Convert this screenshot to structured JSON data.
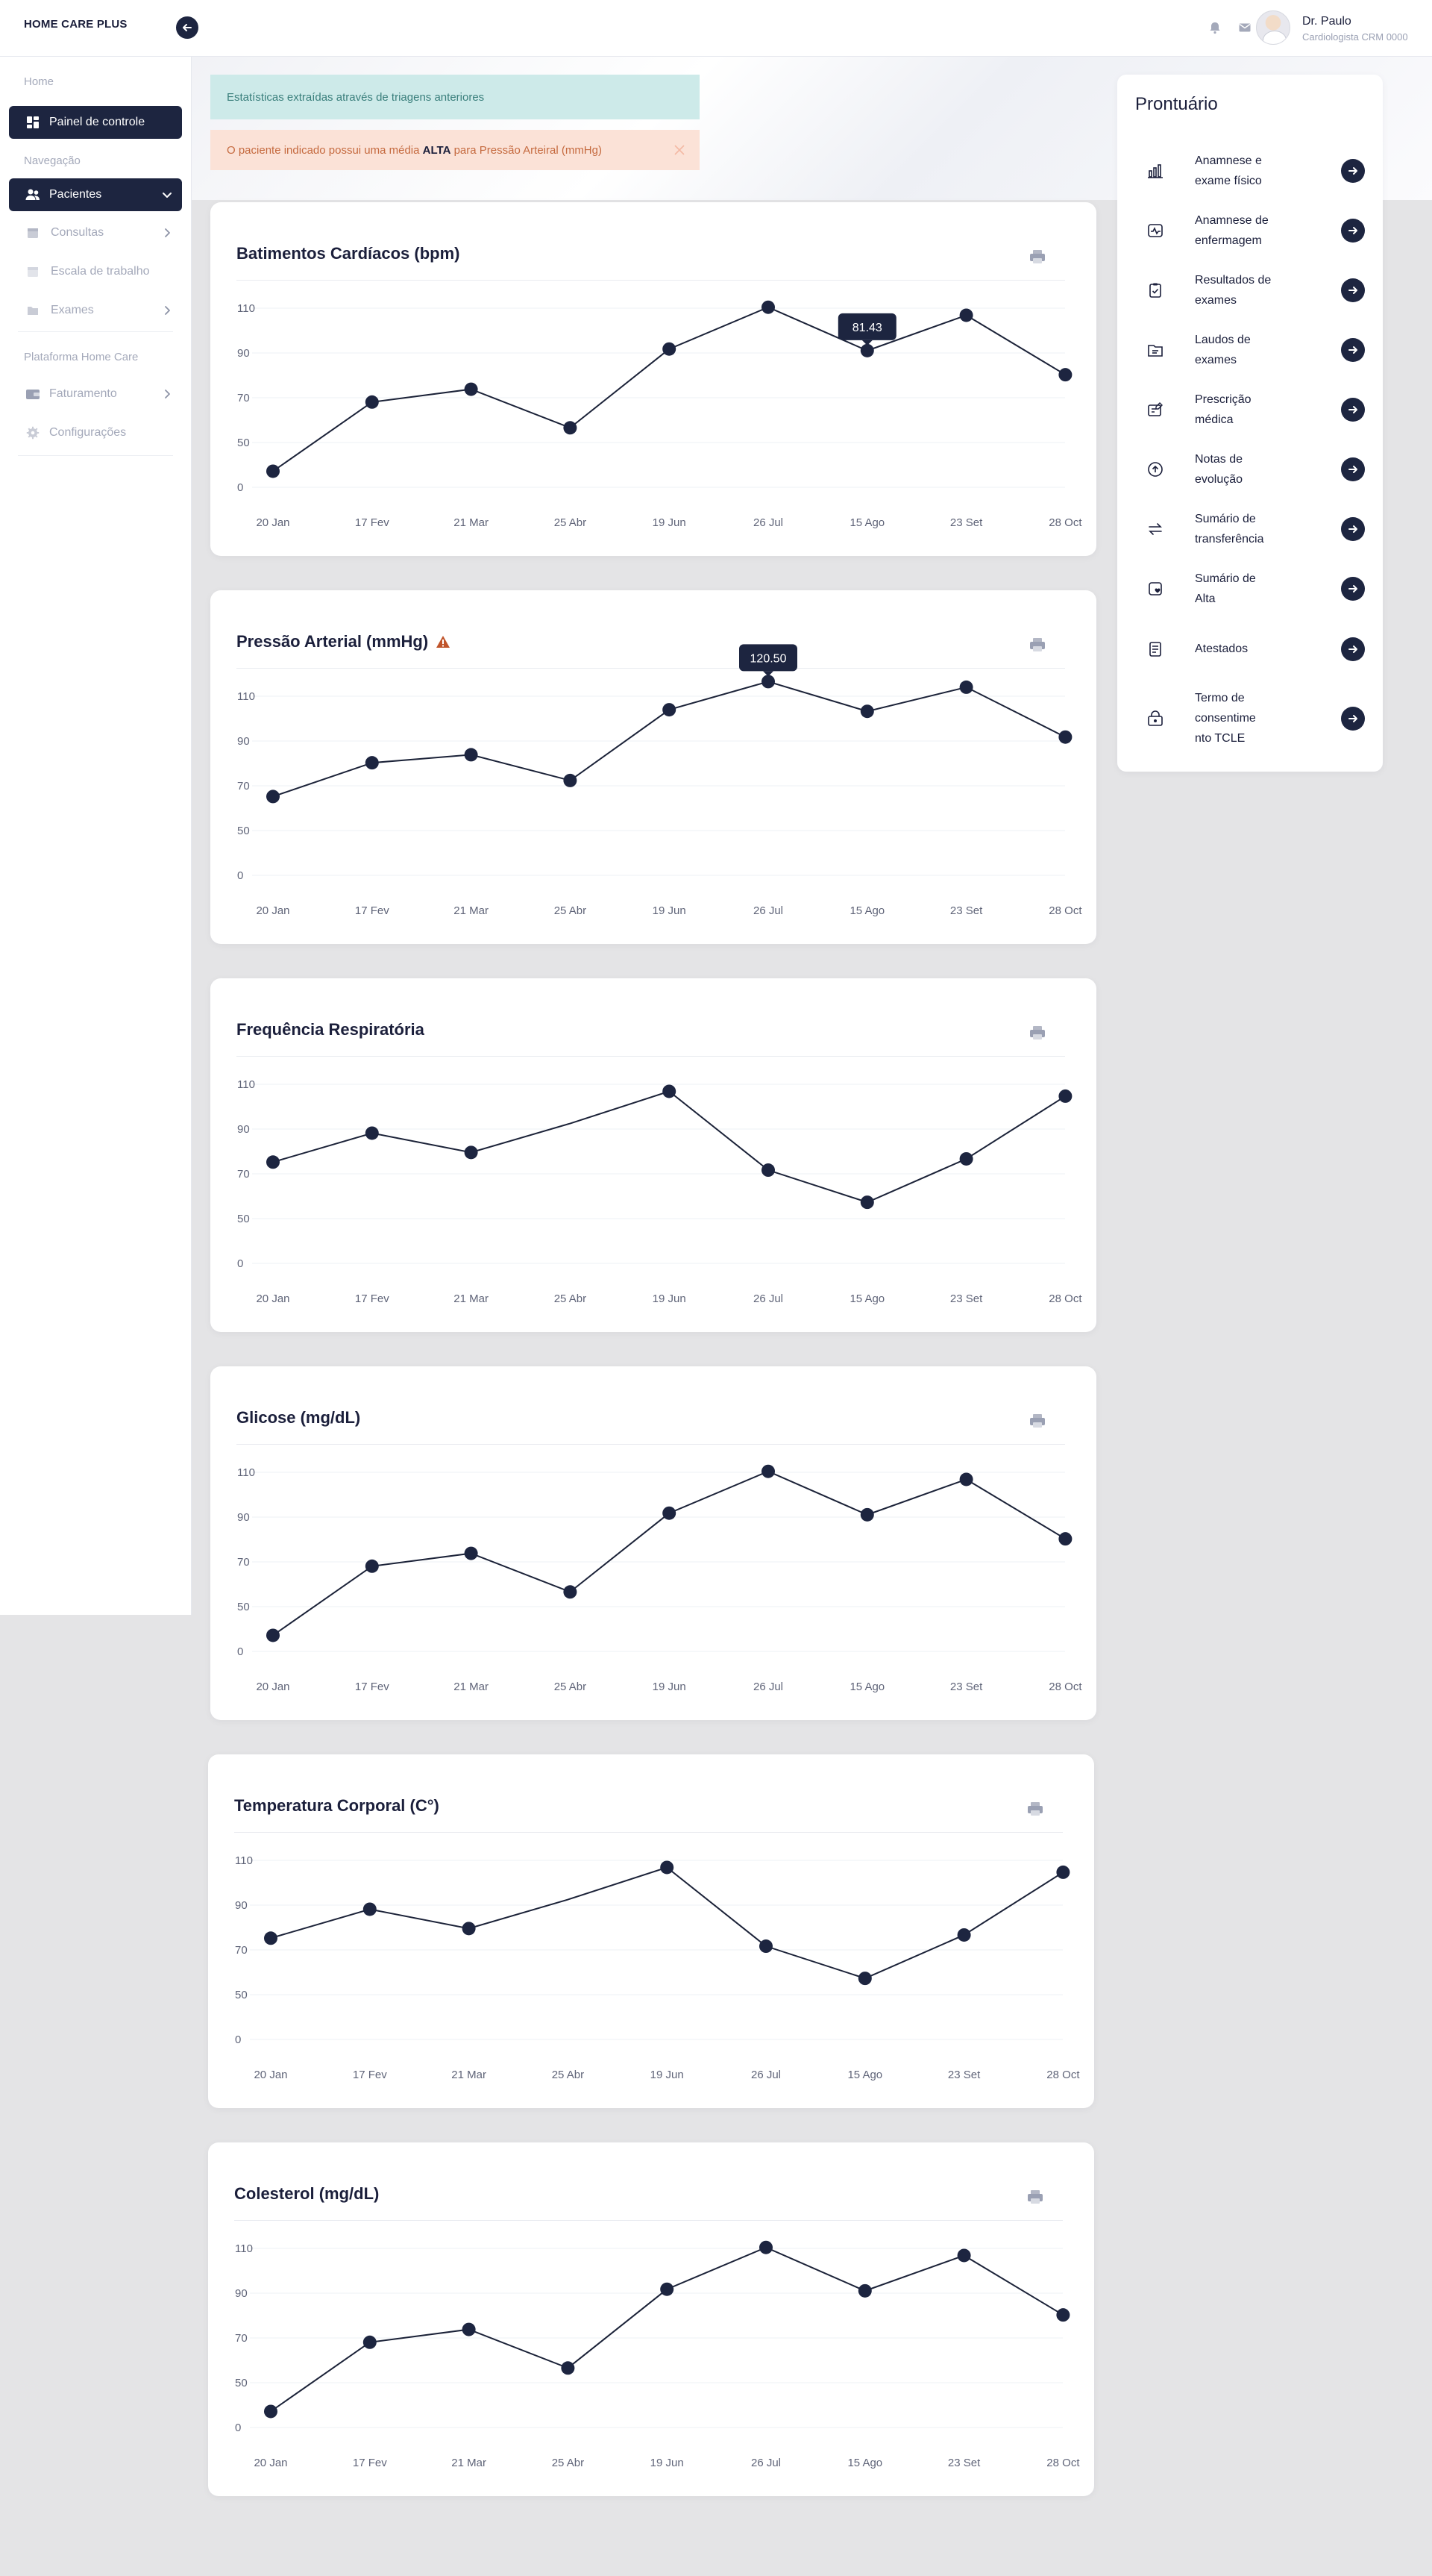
{
  "app": {
    "brand": "HOME CARE PLUS"
  },
  "user": {
    "name": "Dr. Paulo",
    "role": "Cardiologista CRM 0000"
  },
  "sidebar": {
    "sections": {
      "home": "Home",
      "nav": "Navegação",
      "platform": "Plataforma Home Care"
    },
    "items": [
      {
        "label": "Painel de controle",
        "icon": "dashboard-icon"
      },
      {
        "label": "Pacientes",
        "icon": "users-icon"
      },
      {
        "label": "Consultas",
        "icon": "calendar-icon"
      },
      {
        "label": "Escala de trabalho",
        "icon": "calendar-icon"
      },
      {
        "label": "Exames",
        "icon": "folder-icon"
      },
      {
        "label": "Faturamento",
        "icon": "wallet-icon"
      },
      {
        "label": "Configurações",
        "icon": "gear-icon"
      }
    ]
  },
  "alerts": {
    "info": "Estatísticas extraídas através de triagens anteriores",
    "warn_prefix": "O paciente indicado possui uma média ",
    "warn_bold": "ALTA",
    "warn_suffix": " para Pressão Arteiral (mmHg)"
  },
  "panel": {
    "title": "Prontuário",
    "items": [
      {
        "line1": "Anamnese e",
        "line2": "exame físico",
        "line3": ""
      },
      {
        "line1": "Anamnese de",
        "line2": "enfermagem",
        "line3": ""
      },
      {
        "line1": "Resultados de",
        "line2": "exames",
        "line3": ""
      },
      {
        "line1": "Laudos de",
        "line2": "exames",
        "line3": ""
      },
      {
        "line1": "Prescrição",
        "line2": "médica",
        "line3": ""
      },
      {
        "line1": "Notas de",
        "line2": "evolução",
        "line3": ""
      },
      {
        "line1": "Sumário de",
        "line2": "transferência",
        "line3": ""
      },
      {
        "line1": "Sumário de",
        "line2": "Alta",
        "line3": ""
      },
      {
        "line1": "Atestados",
        "line2": "",
        "line3": ""
      },
      {
        "line1": "Termo de",
        "line2": "consentime",
        "line3": "nto TCLE"
      }
    ]
  },
  "colors": {
    "navy": "#1d2540",
    "line": "#1b2238",
    "grid": "#eef0f4"
  },
  "chart_data": [
    {
      "type": "line",
      "title": "Batimentos Cardíacos (bpm)",
      "categories": [
        "20 Jan",
        "17 Fev",
        "21 Mar",
        "25 Abr",
        "19 Jun",
        "26 Jul",
        "15 Ago",
        "23 Set",
        "28 Oct"
      ],
      "yticks": [
        0,
        50,
        70,
        90,
        110
      ],
      "values": [
        10,
        53,
        61,
        37,
        86,
        112,
        85,
        107,
        70
      ],
      "tooltip": {
        "index": 6,
        "text": "81.43"
      },
      "alert_icon": false
    },
    {
      "type": "line",
      "title": "Pressão Arterial (mmHg)",
      "categories": [
        "20 Jan",
        "17 Fev",
        "21 Mar",
        "25 Abr",
        "19 Jun",
        "26 Jul",
        "15 Ago",
        "23 Set",
        "28 Oct"
      ],
      "yticks": [
        0,
        50,
        70,
        90,
        110
      ],
      "values": [
        49,
        70,
        75,
        59,
        103,
        120.5,
        102,
        117,
        86
      ],
      "tooltip": {
        "index": 5,
        "text": "120.50"
      },
      "alert_icon": true
    },
    {
      "type": "line",
      "title": "Frequência Respiratória",
      "categories": [
        "20 Jan",
        "17 Fev",
        "21 Mar",
        "25 Abr",
        "19 Jun",
        "26 Jul",
        "15 Ago",
        "23 Set",
        "28 Oct"
      ],
      "yticks": [
        0,
        50,
        70,
        90,
        110
      ],
      "values": [
        63,
        81,
        69,
        87,
        107,
        58,
        38,
        65,
        104
      ],
      "markers": [
        true,
        true,
        true,
        false,
        true,
        true,
        true,
        true,
        true
      ],
      "alert_icon": false
    },
    {
      "type": "line",
      "title": "Glicose (mg/dL)",
      "categories": [
        "20 Jan",
        "17 Fev",
        "21 Mar",
        "25 Abr",
        "19 Jun",
        "26 Jul",
        "15 Ago",
        "23 Set",
        "28 Oct"
      ],
      "yticks": [
        0,
        50,
        70,
        90,
        110
      ],
      "values": [
        10,
        53,
        61,
        37,
        86,
        112,
        85,
        107,
        70
      ],
      "alert_icon": false
    },
    {
      "type": "line",
      "title": "Temperatura Corporal (C°)",
      "categories": [
        "20 Jan",
        "17 Fev",
        "21 Mar",
        "25 Abr",
        "19 Jun",
        "26 Jul",
        "15 Ago",
        "23 Set",
        "28 Oct"
      ],
      "yticks": [
        0,
        50,
        70,
        90,
        110
      ],
      "values": [
        63,
        81,
        69,
        87,
        107,
        58,
        38,
        65,
        104
      ],
      "markers": [
        true,
        true,
        true,
        false,
        true,
        true,
        true,
        true,
        true
      ],
      "alert_icon": false
    },
    {
      "type": "line",
      "title": "Colesterol (mg/dL)",
      "categories": [
        "20 Jan",
        "17 Fev",
        "21 Mar",
        "25 Abr",
        "19 Jun",
        "26 Jul",
        "15 Ago",
        "23 Set",
        "28 Oct"
      ],
      "yticks": [
        0,
        50,
        70,
        90,
        110
      ],
      "values": [
        10,
        53,
        61,
        37,
        86,
        112,
        85,
        107,
        70
      ],
      "alert_icon": false
    }
  ]
}
